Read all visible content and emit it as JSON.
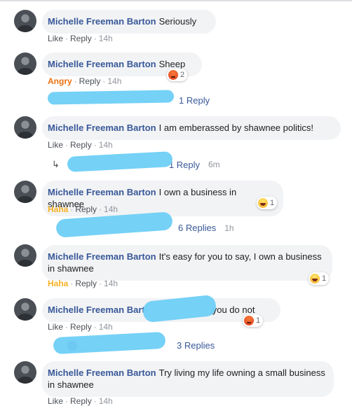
{
  "comments": [
    {
      "author": "Michelle Freeman Barton",
      "text": "Seriously",
      "reaction_label": "Like",
      "reply_label": "Reply",
      "time": "14h"
    },
    {
      "author": "Michelle Freeman Barton",
      "text": "Sheep",
      "reaction_label": "Angry",
      "reply_label": "Reply",
      "time": "14h",
      "reaction_icon": "angry-emoji-icon",
      "reaction_count": "2",
      "replies": "1 Reply"
    },
    {
      "author": "Michelle Freeman Barton",
      "text": "I am emberassed by shawnee politics!",
      "reaction_label": "Like",
      "reply_label": "Reply",
      "time": "14h",
      "replies": "1 Reply",
      "replies_time": "6m"
    },
    {
      "author": "Michelle Freeman Barton",
      "text": "I own a business in shawnee",
      "reaction_label": "Haha",
      "reply_label": "Reply",
      "time": "14h",
      "reaction_icon": "haha-emoji-icon",
      "reaction_count": "1",
      "replies": "6 Replies",
      "replies_time": "1h"
    },
    {
      "author": "Michelle Freeman Barton",
      "text": "It's easy for you to say, I own a business in shawnee",
      "reaction_label": "Haha",
      "reply_label": "Reply",
      "time": "14h",
      "reaction_icon": "haha-emoji-icon",
      "reaction_count": "1"
    },
    {
      "author": "Michelle Freeman Bart",
      "text": "you do not",
      "reaction_label": "Like",
      "reply_label": "Reply",
      "time": "14h",
      "reaction_icon": "angry-emoji-icon",
      "reaction_count": "1",
      "replies": "3 Replies"
    },
    {
      "author": "Michelle Freeman Barton",
      "text": "Try living my life owning a small business in shawnee",
      "reaction_label": "Like",
      "reply_label": "Reply",
      "time": "14h"
    }
  ],
  "colors": {
    "link": "#385898",
    "muted": "#90949c",
    "bubble": "#f2f3f5",
    "angry": "#e9710f",
    "haha": "#f7b125",
    "redaction": "#6ecff6"
  }
}
